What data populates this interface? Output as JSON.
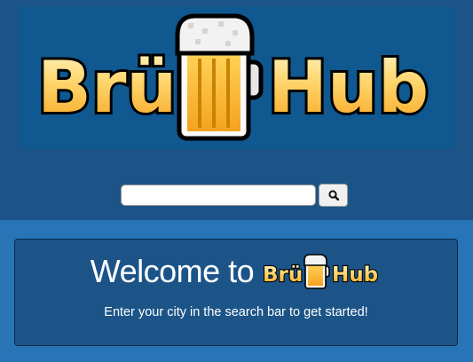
{
  "brand": {
    "name_part1": "Brü",
    "name_part2": "Hub"
  },
  "search": {
    "value": "",
    "placeholder": "",
    "button_icon": "search-icon"
  },
  "welcome": {
    "title": "Welcome to",
    "subtitle": "Enter your city in the search bar to get started!"
  },
  "colors": {
    "page_bg": "#2775b6",
    "header_bg": "#1c5488",
    "banner_bg": "#0f5890",
    "logo_gold": "#f9b42c",
    "logo_light": "#fff3b0"
  }
}
